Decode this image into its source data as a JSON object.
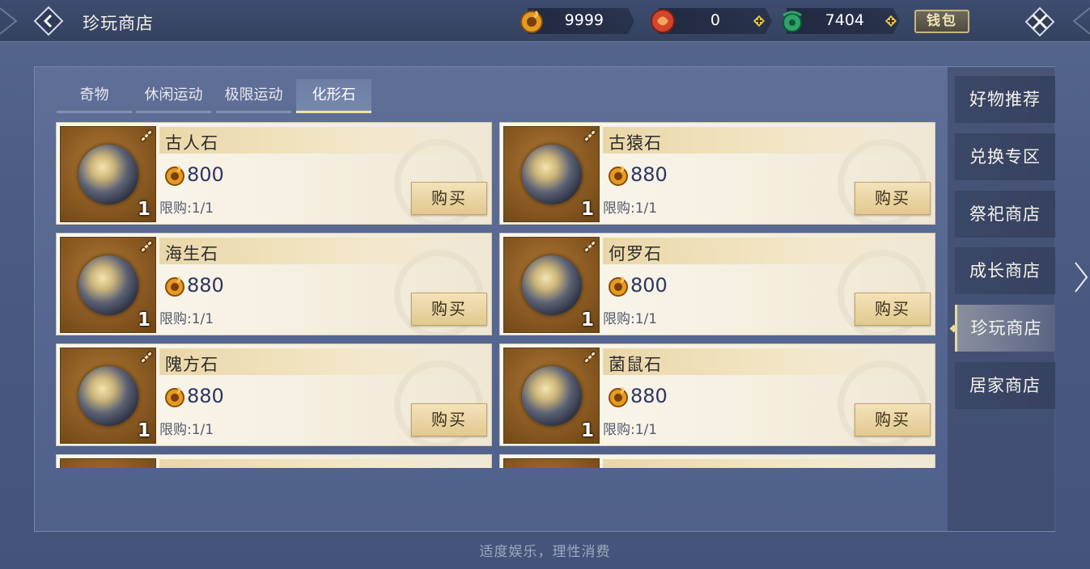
{
  "header": {
    "title": "珍玩商店",
    "wallet_label": "钱包",
    "currencies": [
      {
        "icon": "gold-coin-icon",
        "value": "9999"
      },
      {
        "icon": "red-token-icon",
        "value": "0"
      },
      {
        "icon": "jade-dragon-icon",
        "value": "7404"
      }
    ]
  },
  "tabs": [
    {
      "label": "奇物",
      "active": false
    },
    {
      "label": "休闲运动",
      "active": false
    },
    {
      "label": "极限运动",
      "active": false
    },
    {
      "label": "化形石",
      "active": true
    }
  ],
  "items": [
    {
      "name": "古人石",
      "price": "800",
      "qty": "1",
      "limit": "限购:1/1",
      "buy_label": "购买"
    },
    {
      "name": "古猿石",
      "price": "880",
      "qty": "1",
      "limit": "限购:1/1",
      "buy_label": "购买"
    },
    {
      "name": "海生石",
      "price": "880",
      "qty": "1",
      "limit": "限购:1/1",
      "buy_label": "购买"
    },
    {
      "name": "何罗石",
      "price": "800",
      "qty": "1",
      "limit": "限购:1/1",
      "buy_label": "购买"
    },
    {
      "name": "隗方石",
      "price": "880",
      "qty": "1",
      "limit": "限购:1/1",
      "buy_label": "购买"
    },
    {
      "name": "菌鼠石",
      "price": "880",
      "qty": "1",
      "limit": "限购:1/1",
      "buy_label": "购买"
    }
  ],
  "side_nav": [
    {
      "label": "好物推荐",
      "active": false
    },
    {
      "label": "兑换专区",
      "active": false
    },
    {
      "label": "祭祀商店",
      "active": false
    },
    {
      "label": "成长商店",
      "active": false
    },
    {
      "label": "珍玩商店",
      "active": true
    },
    {
      "label": "居家商店",
      "active": false
    }
  ],
  "footer": {
    "note": "适度娱乐，理性消费"
  },
  "colors": {
    "accent": "#e7d9a0",
    "card_bg": "#f6f0e2",
    "panel": "#566791"
  }
}
